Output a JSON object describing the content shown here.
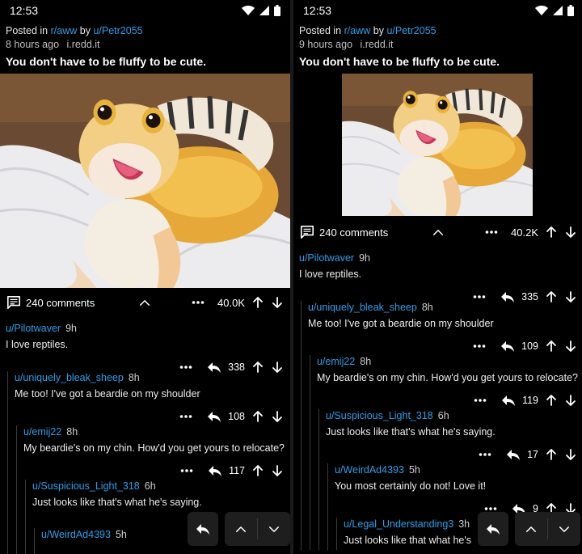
{
  "left": {
    "time": "12:53",
    "posted_in_prefix": "Posted in",
    "subreddit": "r/aww",
    "by": "by",
    "author": "u/Petr2055",
    "age": "8 hours ago",
    "domain": "i.redd.it",
    "title": "You don't have to be fluffy to be cute.",
    "comments_label": "240 comments",
    "score": "40.0K",
    "comments": [
      {
        "user": "u/Pilotwaver",
        "age": "9h",
        "body": "I love reptiles.",
        "score": "338"
      },
      {
        "user": "u/uniquely_bleak_sheep",
        "age": "8h",
        "body": "Me too! I've got a beardie on my shoulder",
        "score": "108"
      },
      {
        "user": "u/emij22",
        "age": "8h",
        "body": "My beardie's on my chin. How'd you get yours to relocate?",
        "score": "117"
      },
      {
        "user": "u/Suspicious_Light_318",
        "age": "6h",
        "body": "Just looks like that's what he's saying.",
        "score": ""
      },
      {
        "user": "u/WeirdAd4393",
        "age": "5h",
        "body": "",
        "score": ""
      }
    ]
  },
  "right": {
    "time": "12:53",
    "posted_in_prefix": "Posted in",
    "subreddit": "r/aww",
    "by": "by",
    "author": "u/Petr2055",
    "age": "9 hours ago",
    "domain": "i.redd.it",
    "title": "You don't have to be fluffy to be cute.",
    "comments_label": "240 comments",
    "score": "40.2K",
    "comments": [
      {
        "user": "u/Pilotwaver",
        "age": "9h",
        "body": "I love reptiles.",
        "score": "335"
      },
      {
        "user": "u/uniquely_bleak_sheep",
        "age": "8h",
        "body": "Me too! I've got a beardie on my shoulder",
        "score": "109"
      },
      {
        "user": "u/emij22",
        "age": "8h",
        "body": "My beardie's on my chin. How'd you get yours to relocate?",
        "score": "119"
      },
      {
        "user": "u/Suspicious_Light_318",
        "age": "6h",
        "body": "Just looks like that's what he's saying.",
        "score": "17"
      },
      {
        "user": "u/WeirdAd4393",
        "age": "5h",
        "body": "You most certainly do not! Love it!",
        "score": "9"
      },
      {
        "user": "u/Legal_Understanding3",
        "age": "3h",
        "body": "Just looks like that what he's",
        "score": ""
      }
    ]
  },
  "icons": {
    "wifi": "wifi-icon",
    "signal": "signal-icon",
    "battery": "battery-icon",
    "comments": "comment-bubble-icon",
    "more": "more-dots-icon",
    "reply": "reply-icon",
    "upvote": "upvote-arrow-icon",
    "downvote": "downvote-arrow-icon",
    "collapse": "chevron-up-icon"
  },
  "colors": {
    "link": "#2f9ee8",
    "background": "#000000",
    "thread_line": "#3a3a3a",
    "floating_button": "#1e1e1e"
  }
}
